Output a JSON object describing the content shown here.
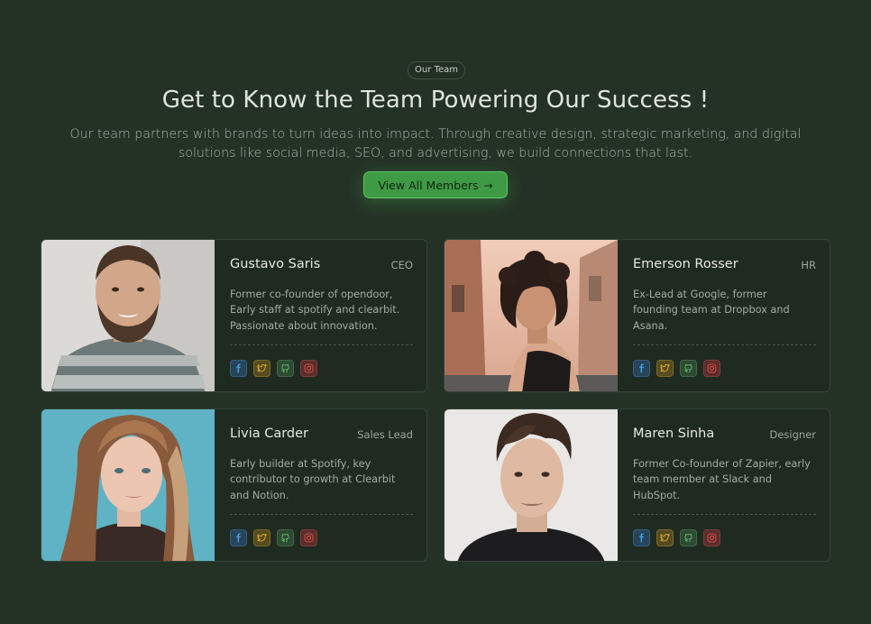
{
  "header": {
    "badge": "Our Team",
    "title": "Get to Know the Team Powering Our Success !",
    "subtitle": "Our team partners with brands to turn ideas into impact. Through creative design, strategic marketing, and digital solutions like social media, SEO, and advertising, we build connections that last.",
    "cta_label": "View All Members",
    "cta_arrow": "→"
  },
  "colors": {
    "background": "#243226",
    "accent": "#3e9a45",
    "facebook": "#3fa0e0",
    "twitter": "#e0b02a",
    "github": "#6cc474",
    "instagram": "#e0504a"
  },
  "members": [
    {
      "name": "Gustavo Saris",
      "role": "CEO",
      "bio": "Former co-founder of opendoor, Early staff at spotify and clearbit. Passionate about innovation.",
      "socials": [
        "facebook-icon",
        "twitter-icon",
        "github-icon",
        "instagram-icon"
      ]
    },
    {
      "name": "Emerson Rosser",
      "role": "HR",
      "bio": "Ex-Lead at Google, former founding team at Dropbox and Asana.",
      "socials": [
        "facebook-icon",
        "twitter-icon",
        "github-icon",
        "instagram-icon"
      ]
    },
    {
      "name": "Livia Carder",
      "role": "Sales Lead",
      "bio": "Early builder at Spotify, key contributor to growth at Clearbit and Notion.",
      "socials": [
        "facebook-icon",
        "twitter-icon",
        "github-icon",
        "instagram-icon"
      ]
    },
    {
      "name": "Maren Sinha",
      "role": "Designer",
      "bio": "Former Co-founder of Zapier, early team member at Slack and HubSpot.",
      "socials": [
        "facebook-icon",
        "twitter-icon",
        "github-icon",
        "instagram-icon"
      ]
    }
  ]
}
